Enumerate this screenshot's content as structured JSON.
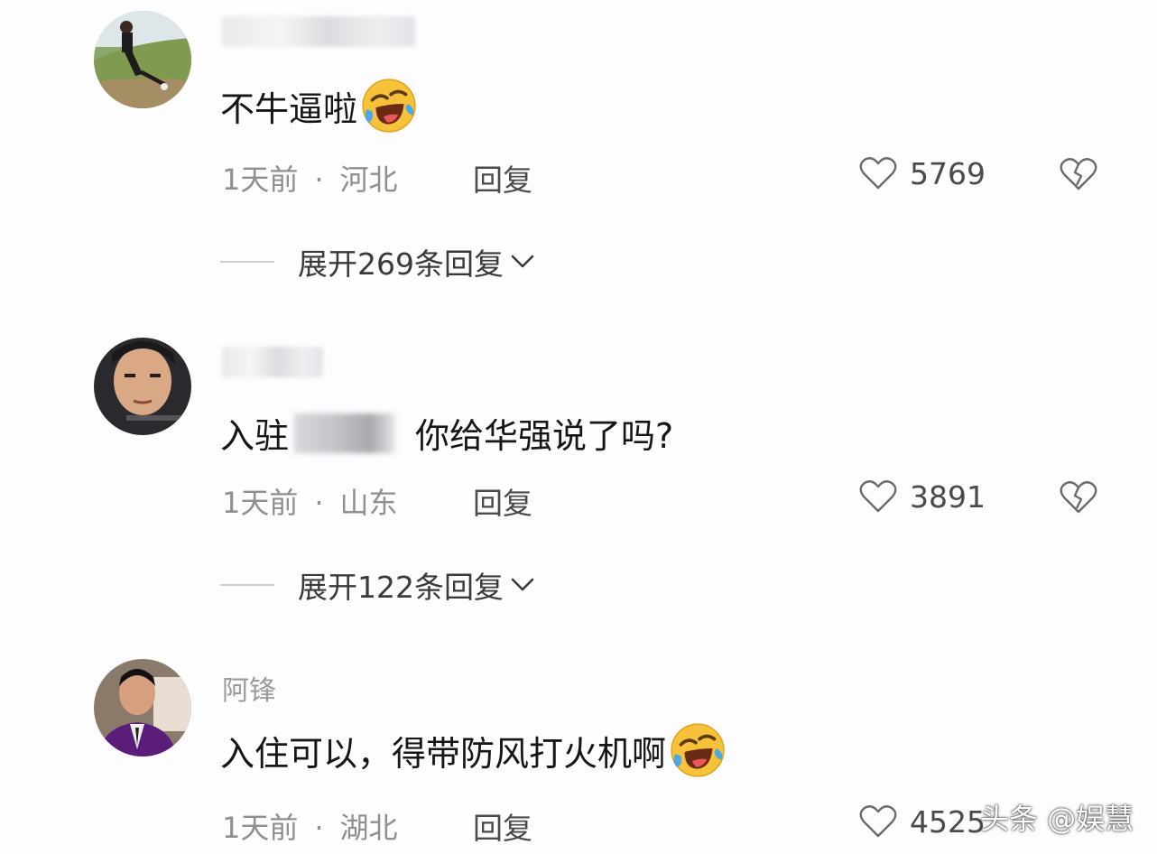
{
  "comments": [
    {
      "username": "",
      "text": "不牛逼啦",
      "has_emoji": true,
      "time": "1天前",
      "dot": "·",
      "location": "河北",
      "reply_label": "回复",
      "likes": "5769",
      "expand_label": "展开269条回复"
    },
    {
      "username": "",
      "text_before": "入驻",
      "text_after": "你给华强说了吗?",
      "time": "1天前",
      "dot": "·",
      "location": "山东",
      "reply_label": "回复",
      "likes": "3891",
      "expand_label": "展开122条回复"
    },
    {
      "username": "阿锋",
      "text": "入住可以，得带防风打火机啊",
      "has_emoji": true,
      "time": "1天前",
      "dot": "·",
      "location": "湖北",
      "reply_label": "回复",
      "likes": "4525"
    }
  ],
  "watermark": "头条 @娱慧",
  "colors": {
    "background": "#fdfcfe",
    "meta_text": "#8e8e93",
    "emoji_yellow": "#f7c23a"
  }
}
